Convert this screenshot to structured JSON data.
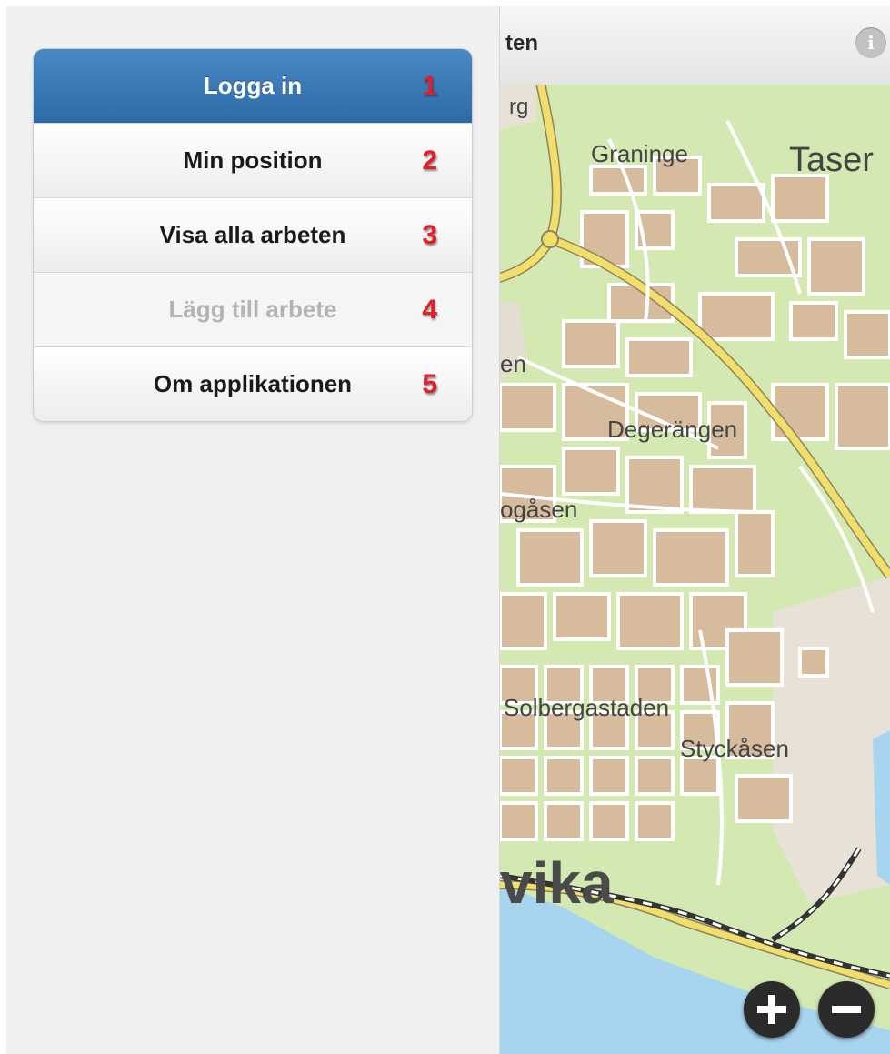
{
  "menu": {
    "items": [
      {
        "label": "Logga in",
        "number": "1"
      },
      {
        "label": "Min position",
        "number": "2"
      },
      {
        "label": "Visa alla arbeten",
        "number": "3"
      },
      {
        "label": "Lägg till arbete",
        "number": "4"
      },
      {
        "label": "Om applikationen",
        "number": "5"
      }
    ]
  },
  "map": {
    "header_title": "ten",
    "info_icon": "info-icon",
    "labels": {
      "graninge": "Graninge",
      "tase": "Taser",
      "g_fragment": "rg",
      "en_fragment": "en",
      "degerangen": "Degerängen",
      "gasen": "ogåsen",
      "solbergastaden": "Solbergastaden",
      "styckasen": "Styckåsen",
      "vika": "vika"
    },
    "zoom_in_icon": "plus-icon",
    "zoom_out_icon": "minus-icon"
  },
  "colors": {
    "menu_active": "#2c6aa8",
    "number_red": "#e0202a",
    "map_green": "#d3e9b1",
    "map_built": "#d6bb9d",
    "map_road_major": "#f2df6b",
    "map_water": "#a7d4ef"
  }
}
